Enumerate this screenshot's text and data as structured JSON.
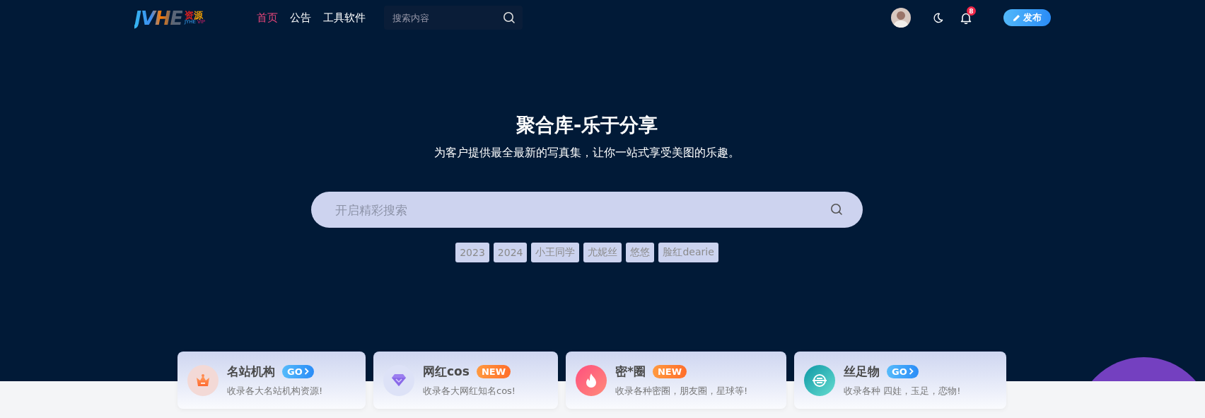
{
  "header": {
    "logo": {
      "mark": "JVHE",
      "cn": "资源",
      "sub": "JYHE",
      "vip": "VIP"
    },
    "nav": [
      {
        "label": "首页",
        "selected": true
      },
      {
        "label": "公告",
        "selected": false
      },
      {
        "label": "工具软件",
        "selected": false
      }
    ],
    "search": {
      "placeholder": "搜索内容"
    },
    "notifications": {
      "count": "8"
    },
    "publish_button": "发布"
  },
  "hero": {
    "title": "聚合库-乐于分享",
    "subtitle": "为客户提供最全最新的写真集，让你一站式享受美图的乐趣。",
    "search": {
      "placeholder": "开启精彩搜索"
    },
    "tags": [
      "2023",
      "2024",
      "小王同学",
      "尤妮丝",
      "悠悠",
      "脸红dearie"
    ]
  },
  "cards": [
    {
      "kind": "crown",
      "title": "名站机构",
      "badge": {
        "kind": "go",
        "label": "GO"
      },
      "description": "收录各大名站机构资源!"
    },
    {
      "kind": "diamond",
      "title": "网红cos",
      "badge": {
        "kind": "new",
        "label": "NEW"
      },
      "description": "收录各大网红知名cos!"
    },
    {
      "kind": "flame",
      "title": "密*圈",
      "badge": {
        "kind": "new",
        "label": "NEW"
      },
      "description": "收录各种密圈，朋友圈，星球等!"
    },
    {
      "kind": "coin",
      "title": "丝足物",
      "badge": {
        "kind": "go",
        "label": "GO"
      },
      "description": "收录各种 四娃，玉足，恋物!"
    }
  ]
}
